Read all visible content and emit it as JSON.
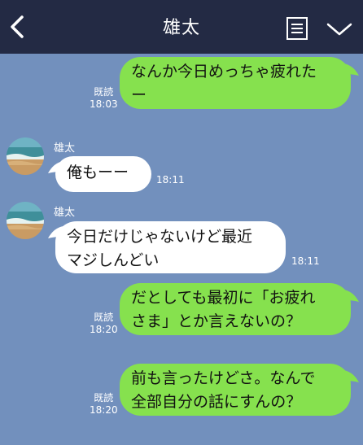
{
  "header": {
    "title": "雄太",
    "back_icon": "chevron-left-icon",
    "memo_icon": "memo-list-icon",
    "menu_icon": "chevron-down-icon"
  },
  "messages": [
    {
      "side": "me",
      "text": "なんか今日めっちゃ疲れた\nー",
      "read": "既読",
      "time": "18:03"
    },
    {
      "side": "them",
      "sender": "雄太",
      "text": "俺もーー",
      "time": "18:11"
    },
    {
      "side": "them",
      "sender": "雄太",
      "text": "今日だけじゃないけど最近\nマジしんどい",
      "time": "18:11"
    },
    {
      "side": "me",
      "text": "だとしても最初に「お疲れ\nさま」とか言えないの？",
      "read": "既読",
      "time": "18:20"
    },
    {
      "side": "me",
      "text": "前も言ったけどさ。なんで\n全部自分の話にすんの？",
      "read": "既読",
      "time": "18:20"
    }
  ],
  "colors": {
    "background": "#7290bd",
    "header": "#232a44",
    "my_bubble": "#86e14e",
    "their_bubble": "#ffffff"
  }
}
